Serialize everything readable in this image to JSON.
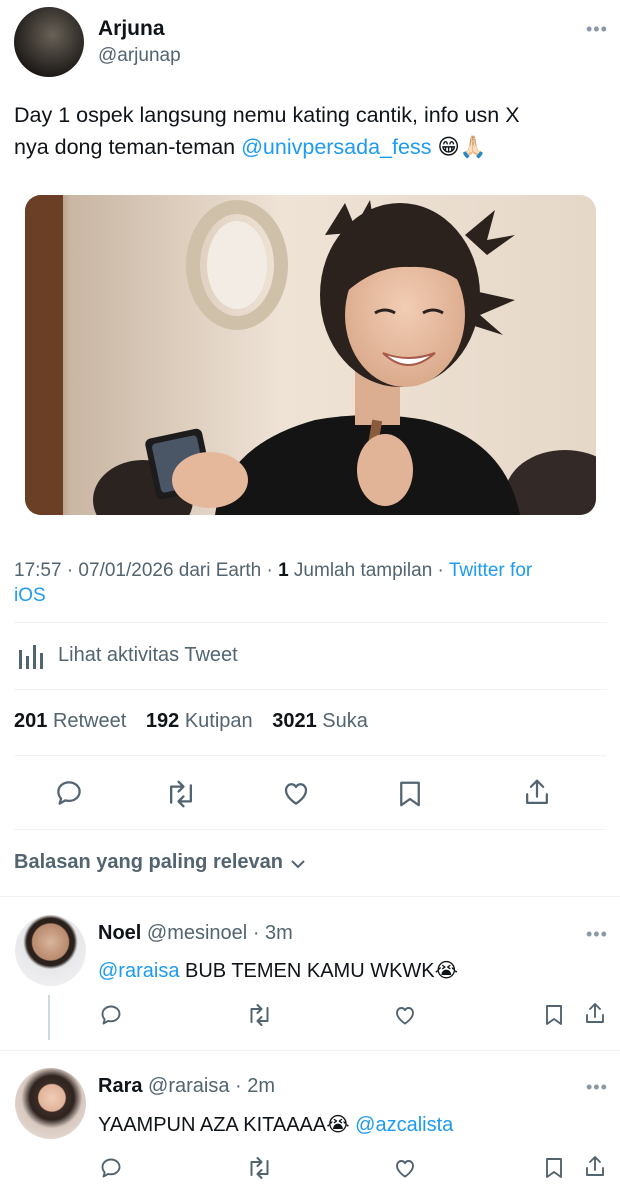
{
  "tweet": {
    "author_name": "Arjuna",
    "author_handle": "@arjunap",
    "text_line1": "Day 1 ospek langsung nemu kating cantik, info usn X",
    "text_line2_prefix": "nya dong teman-teman ",
    "mention": "@univpersada_fess",
    "emoji": "😁🙏🏻",
    "meta_time": "17:57 · 07/01/2026 dari Earth · ",
    "meta_views_count": "1",
    "meta_views_label": " Jumlah tampilan · ",
    "meta_source_part1": "Twitter for",
    "meta_source_part2": "iOS"
  },
  "activity": {
    "label": "Lihat aktivitas Tweet"
  },
  "stats": {
    "retweets_count": "201",
    "retweets_label": "Retweet",
    "quotes_count": "192",
    "quotes_label": "Kutipan",
    "likes_count": "3021",
    "likes_label": "Suka"
  },
  "actions": [
    "reply-icon",
    "retweet-icon",
    "like-icon",
    "bookmark-icon",
    "share-icon"
  ],
  "replies_sort": {
    "label": "Balasan yang paling relevan"
  },
  "replies": [
    {
      "name": "Noel",
      "handle": "@mesinoel",
      "time": "· 3m",
      "mention": "@raraisa",
      "text": " BUB TEMEN KAMU WKWK",
      "emoji": "😭"
    },
    {
      "name": "Rara",
      "handle": "@raraisa",
      "time": "· 2m",
      "text": "YAAMPUN AZA KITAAAA",
      "emoji": "😭",
      "mention": " @azcalista"
    }
  ],
  "colors": {
    "link": "#1d9bf0",
    "muted": "#536471",
    "divider": "#eff3f4",
    "text": "#0f1419"
  }
}
